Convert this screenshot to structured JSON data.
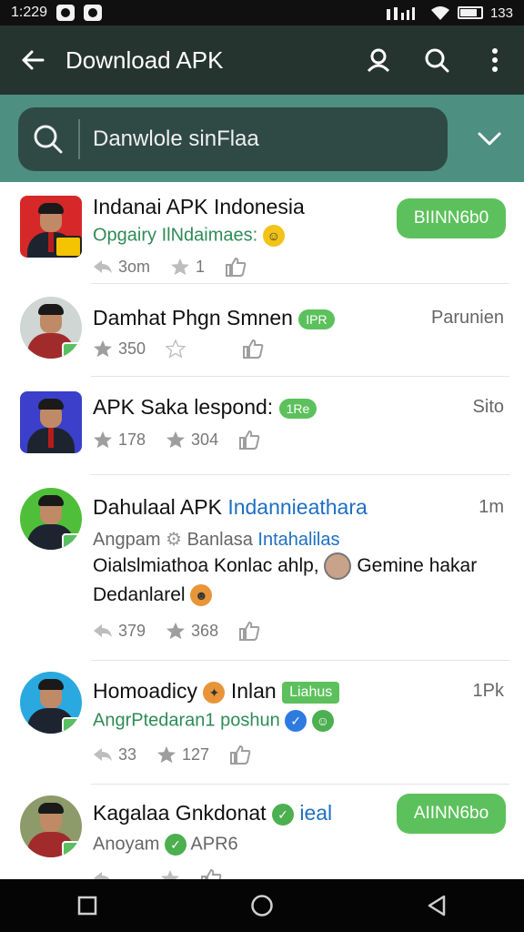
{
  "status_bar": {
    "time": "1:229",
    "right_text": "133"
  },
  "app_bar": {
    "title": "Download APK"
  },
  "search": {
    "value": "Danwlole sinFlaa"
  },
  "items": [
    {
      "name": "Indanai APK Indonesia",
      "subtitle": "Opgairy IlNdaimaes:",
      "stat1": "3om",
      "stat2": "1",
      "button": "BIINN6b0"
    },
    {
      "name": "Damhat Phgn Smnen",
      "pill": "IPR",
      "right": "Parunien",
      "stat1": "350"
    },
    {
      "name": "APK Saka lespond:",
      "pill": "1Re",
      "right": "Sito",
      "stat1": "178",
      "stat2": "304"
    },
    {
      "name": "Dahulaal APK",
      "name_link": "Indannieathara",
      "right": "1m",
      "subtitle_a": "Angpam",
      "subtitle_b": "Banlasa",
      "subtitle_c": "Intahalilas",
      "desc1": "Oialslmiathoa Konlac ahlp,",
      "desc2": "Gemine hakar",
      "desc3": "Dedanlarel",
      "stat1": "379",
      "stat2": "368"
    },
    {
      "name": "Homoadicy",
      "name_b": "Inlan",
      "pill": "Liahus",
      "right": "1Pk",
      "subtitle": "AngrPtedaran1 poshun",
      "stat1": "33",
      "stat2": "127"
    },
    {
      "name": "Kagalaa Gnkdonat",
      "name_link": "ieal",
      "subtitle_a": "Anoyam",
      "subtitle_b": "APR6",
      "button": "AIINN6bo"
    }
  ]
}
